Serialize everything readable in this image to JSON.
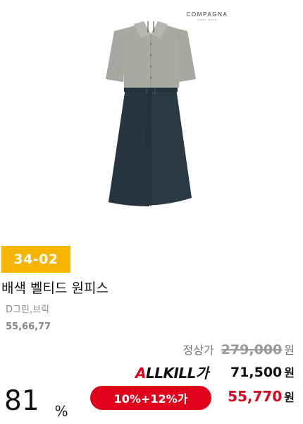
{
  "product": {
    "brand": "COMPAGNA",
    "brand_sub": "FIRST WAVE",
    "code": "34-02",
    "name": "배색 벨티드 원피스",
    "colors": "D그린,브릭",
    "sizes": "55,66,77"
  },
  "pricing": {
    "list_label": "정상가",
    "list_price": "279,000",
    "currency": "원",
    "allkill_a": "A",
    "allkill_rest": "LLKILL가",
    "allkill_price": "71,500",
    "discount_label": "10%+12%가",
    "final_price": "55,770",
    "discount_rate": "81",
    "discount_rate_unit": "%"
  },
  "colors": {
    "badge": "#f5b400",
    "accent_red": "#e1001c",
    "dress_top": "#a7aba3",
    "dress_skirt": "#2a3a44"
  }
}
